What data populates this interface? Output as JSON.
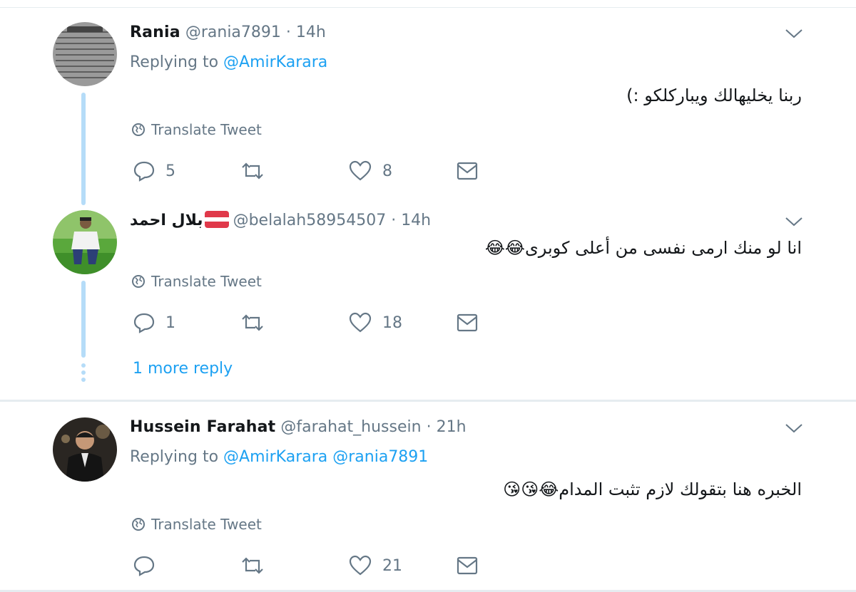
{
  "tweets": [
    {
      "name": "Rania",
      "handle": "@rania7891",
      "time": "14h",
      "replying_prefix": "Replying to",
      "replying_to": [
        "@AmirKarara"
      ],
      "text": "ربنا يخليهالك ويباركلكو :)",
      "translate_label": "Translate Tweet",
      "replies": "5",
      "retweets": "",
      "likes": "8"
    },
    {
      "name": "بلال احمد",
      "handle": "@belalah58954507",
      "time": "14h",
      "text": "انا لو منك ارمى نفسى من أعلى كوبرى😂😂",
      "translate_label": "Translate Tweet",
      "replies": "1",
      "retweets": "",
      "likes": "18"
    },
    {
      "name": "Hussein Farahat",
      "handle": "@farahat_hussein",
      "time": "21h",
      "replying_prefix": "Replying to",
      "replying_to": [
        "@AmirKarara",
        "@rania7891"
      ],
      "text": "الخبره هنا بتقولك لازم تثبت المدام😂😘😘",
      "translate_label": "Translate Tweet",
      "replies": "",
      "retweets": "",
      "likes": "21"
    }
  ],
  "thread": {
    "more_replies_label": "1 more reply"
  },
  "separator_dot": "·",
  "colors": {
    "link": "#1da1f2",
    "muted": "#657786",
    "thread_line": "#b5dcf8",
    "border": "#e6ecf0"
  },
  "icons": [
    "reply-icon",
    "retweet-icon",
    "like-icon",
    "dm-icon",
    "globe-icon",
    "caret-down-icon",
    "flag-icon"
  ]
}
